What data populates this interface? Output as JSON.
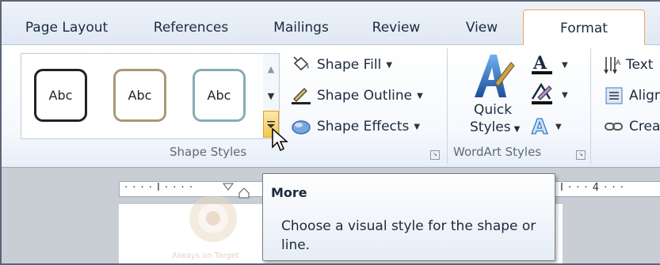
{
  "tabs": [
    "Page Layout",
    "References",
    "Mailings",
    "Review",
    "View",
    "Format"
  ],
  "active_tab": "Format",
  "shape_styles": {
    "gallery_items": [
      {
        "label": "Abc",
        "border_color": "#222222"
      },
      {
        "label": "Abc",
        "border_color": "#a99878"
      },
      {
        "label": "Abc",
        "border_color": "#86adb3"
      }
    ],
    "commands": [
      {
        "label": "Shape Fill",
        "icon": "paint-bucket-icon"
      },
      {
        "label": "Shape Outline",
        "icon": "pencil-outline-icon"
      },
      {
        "label": "Shape Effects",
        "icon": "shape-effects-icon"
      }
    ],
    "group_label": "Shape Styles"
  },
  "wordart_styles": {
    "quick_styles_line1": "Quick",
    "quick_styles_line2": "Styles",
    "group_label": "WordArt Styles"
  },
  "arrange": {
    "items": [
      "Text",
      "Align",
      "Crea"
    ]
  },
  "ruler": {
    "marker": "4"
  },
  "tooltip": {
    "title": "More",
    "description": "Choose a visual style for the shape or line."
  },
  "document": {
    "logo_text": "Always on Target"
  },
  "colors": {
    "active_tab_border": "#f2a950",
    "more_button": "#f7c64e",
    "tab_text": "#1c2a3d"
  }
}
